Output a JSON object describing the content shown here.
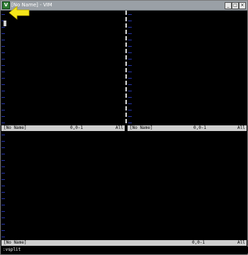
{
  "window": {
    "title": "[No Name] - VIM",
    "app_icon_glyph": "V",
    "buttons": {
      "minimize": "_",
      "maximize": "□",
      "close": "×"
    }
  },
  "panes": {
    "top_left": {
      "status_name": "[No Name]",
      "status_pos": "0,0-1",
      "status_pct": "All"
    },
    "top_right": {
      "status_name": "[No Name]",
      "status_pos": "0,0-1",
      "status_pct": "All"
    },
    "bottom": {
      "status_name": "[No Name]",
      "status_pos": "0,0-1",
      "status_pct": "All"
    }
  },
  "command_line": ":vsplit",
  "colors": {
    "background": "#000000",
    "tilde": "#2432a8",
    "statusline": "#cfcfcf",
    "annotation_arrow": "#f5e61a",
    "titlebar": "#9aa0a6"
  },
  "icons": {
    "app": "vim-icon",
    "annotation": "left-arrow-icon"
  }
}
